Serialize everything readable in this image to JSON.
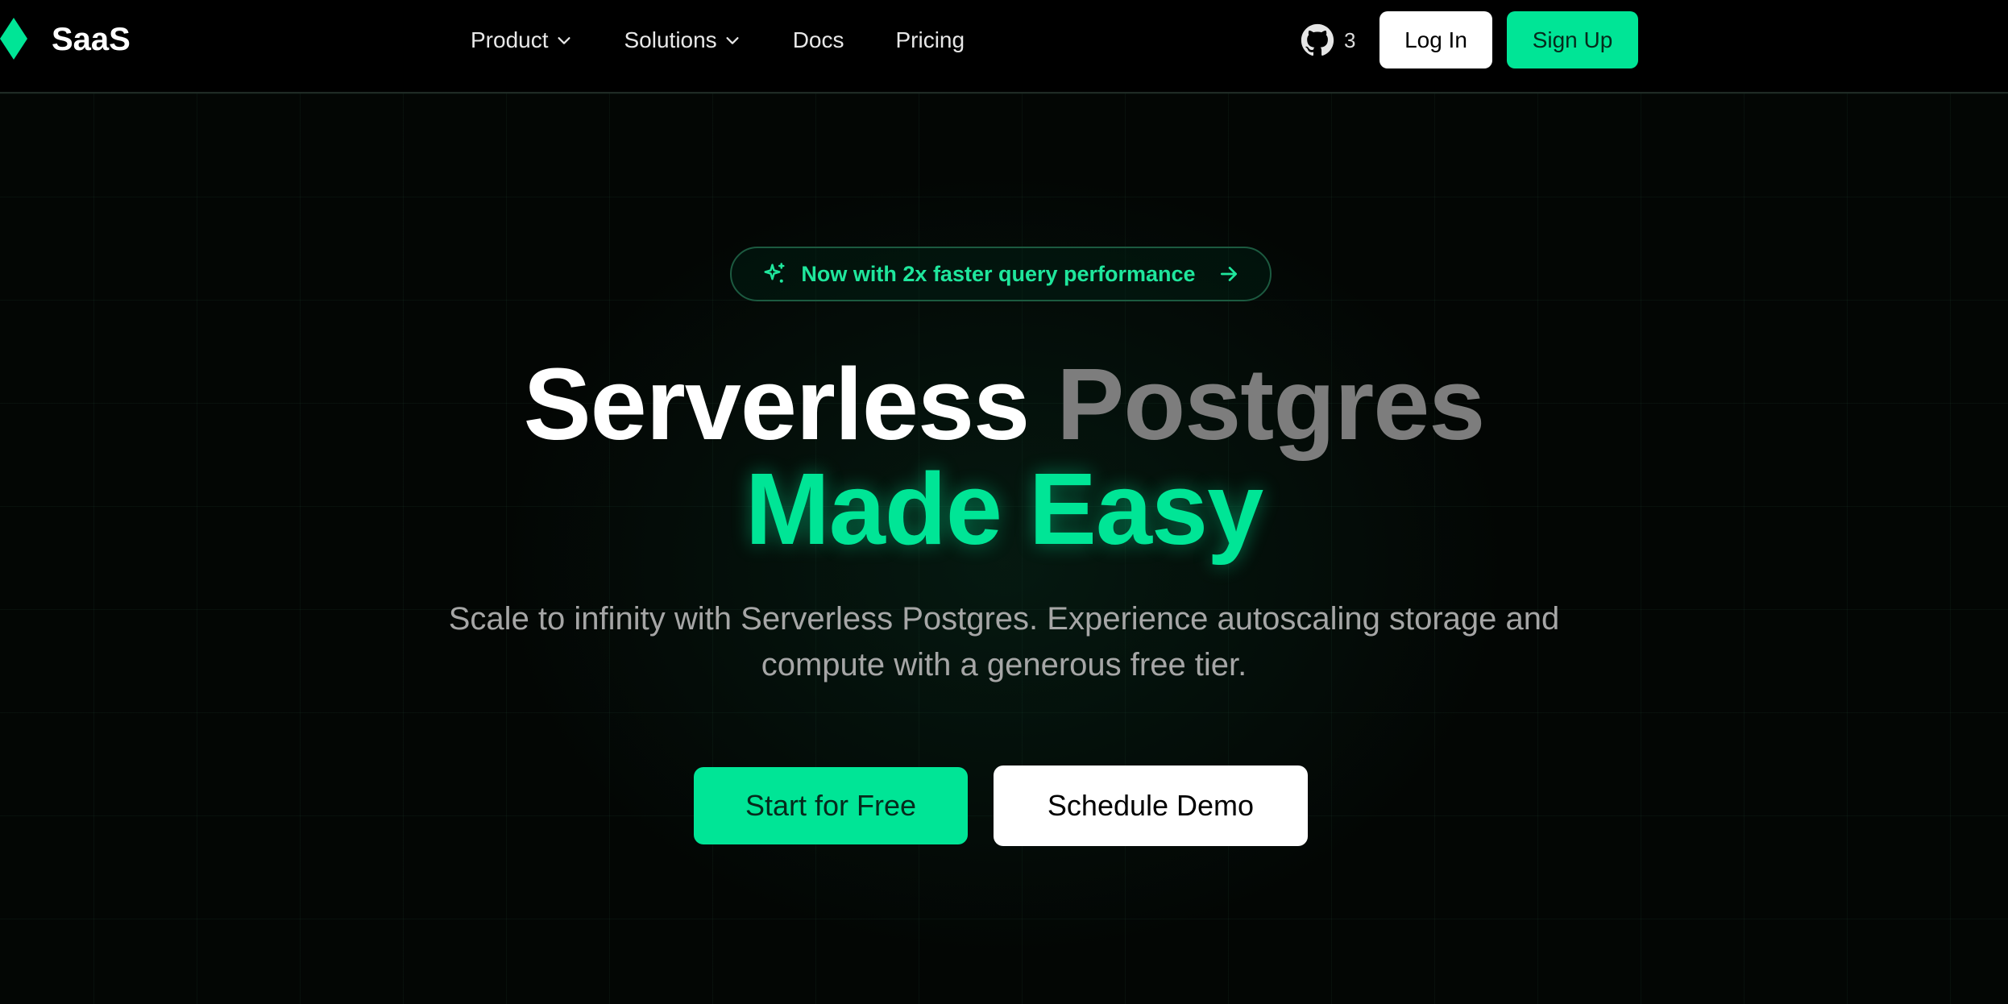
{
  "brand": {
    "name": "SaaS",
    "logo_icon": "diamond-logo-icon",
    "accent": "#00e596"
  },
  "nav": {
    "items": [
      {
        "label": "Product",
        "has_dropdown": true
      },
      {
        "label": "Solutions",
        "has_dropdown": true
      },
      {
        "label": "Docs",
        "has_dropdown": false
      },
      {
        "label": "Pricing",
        "has_dropdown": false
      }
    ],
    "github": {
      "icon": "github-icon",
      "count": "3"
    },
    "login_label": "Log In",
    "signup_label": "Sign Up"
  },
  "hero": {
    "announcement": {
      "text": "Now with 2x faster query performance",
      "icon": "sparkle-icon",
      "arrow_icon": "arrow-right-icon"
    },
    "headline_line1_a": "Serverless",
    "headline_line1_b": "Postgres",
    "headline_line2": "Made Easy",
    "subtitle_line1": "Scale to infinity with Serverless Postgres. Experience autoscaling storage and",
    "subtitle_line2": "compute with a generous free tier.",
    "primary_cta": "Start for Free",
    "secondary_cta": "Schedule Demo"
  },
  "colors": {
    "background": "#030604",
    "accent": "#00e596",
    "headline_grey": "#7d7d7d",
    "subtitle": "#a6a6a6"
  }
}
